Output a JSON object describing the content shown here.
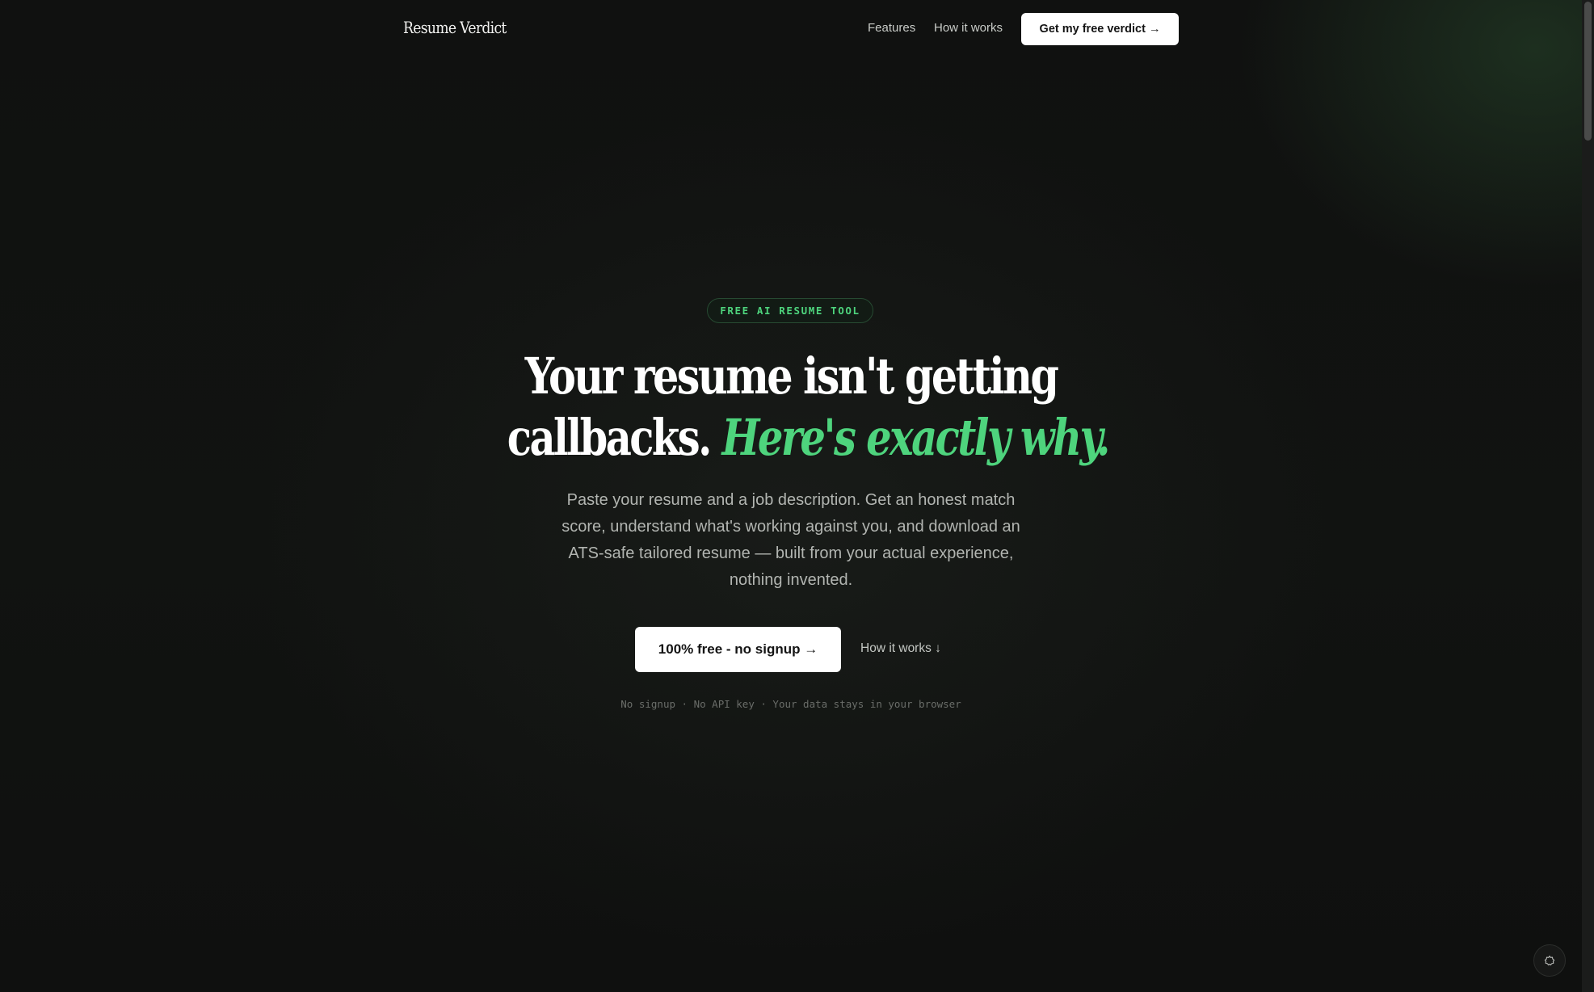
{
  "nav": {
    "logo": "Resume Verdict",
    "links": [
      {
        "label": "Features"
      },
      {
        "label": "How it works"
      }
    ],
    "cta_label": "Get my free verdict →"
  },
  "hero": {
    "badge": "FREE AI RESUME TOOL",
    "headline_line1": "Your resume isn't getting",
    "headline_line2_plain": "callbacks.",
    "headline_line2_accent": "Here's exactly why.",
    "subheadline": "Paste your resume and a job description. Get an honest match score, understand what's working against you, and download an ATS-safe tailored resume — built from your actual experience, nothing invented.",
    "primary_cta": "100% free - no signup →",
    "secondary_cta": "How it works ↓",
    "trust_line": "No signup · No API key · Your data stays in your browser"
  },
  "colors": {
    "background": "#0e0f0e",
    "accent_green": "#4ed47d",
    "button_bg": "#ffffff",
    "button_text": "#141414",
    "muted_text": "#b2b5b1"
  },
  "icons": {
    "floating_button": "settings-icon"
  }
}
